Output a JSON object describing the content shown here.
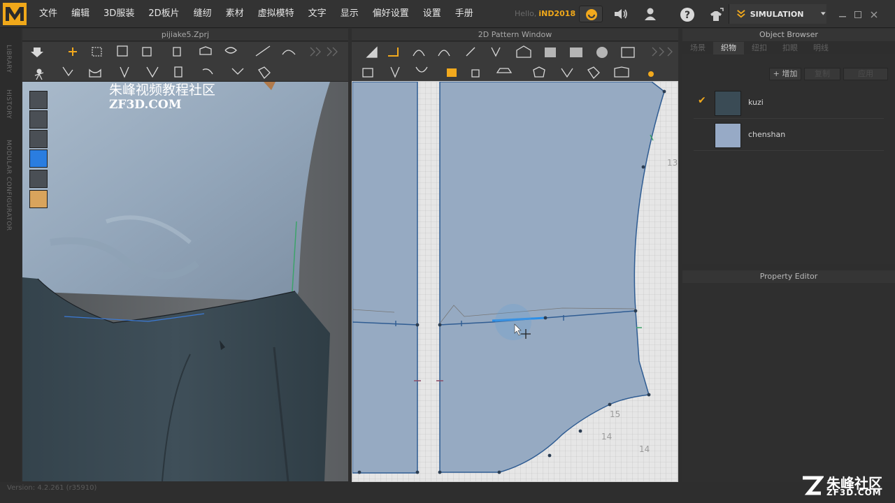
{
  "menu": {
    "items": [
      "文件",
      "编辑",
      "3D服装",
      "2D板片",
      "缝纫",
      "素材",
      "虚拟模特",
      "文字",
      "显示",
      "偏好设置",
      "设置",
      "手册"
    ],
    "hello_prefix": "Hello,",
    "user": "iND2018",
    "simulation_label": "SIMULATION"
  },
  "panes": {
    "view3d_title": "pijiake5.Zprj",
    "view2d_title": "2D Pattern Window"
  },
  "sidebar": {
    "labels": [
      "LIBRARY",
      "HISTORY",
      "MODULAR CONFIGURATOR"
    ]
  },
  "watermark": {
    "title": "朱峰视频教程社区",
    "subtitle": "ZF3D.COM"
  },
  "object_browser": {
    "title": "Object Browser",
    "tabs": [
      "场景",
      "织物",
      "纽扣",
      "扣眼",
      "明线"
    ],
    "active_tab": "织物",
    "buttons": {
      "add": "+ 增加",
      "copy": "复制",
      "apply": "应用"
    },
    "fabrics": [
      {
        "name": "kuzi",
        "color": "#3a4b55",
        "selected": true
      },
      {
        "name": "chenshan",
        "color": "#97aac6",
        "selected": false
      }
    ]
  },
  "property_editor": {
    "title": "Property Editor"
  },
  "pattern_labels": [
    "13",
    "14",
    "15",
    "14"
  ],
  "status": {
    "version": "Version: 4.2.261 (r35910)"
  },
  "brand": {
    "name": "朱峰社区",
    "url": "ZF3D.COM"
  },
  "colors": {
    "accent": "#f2a91d",
    "pattern_fill": "#96aac2",
    "pattern_line": "#2f5c92",
    "selected_line": "#2c8fe8"
  }
}
